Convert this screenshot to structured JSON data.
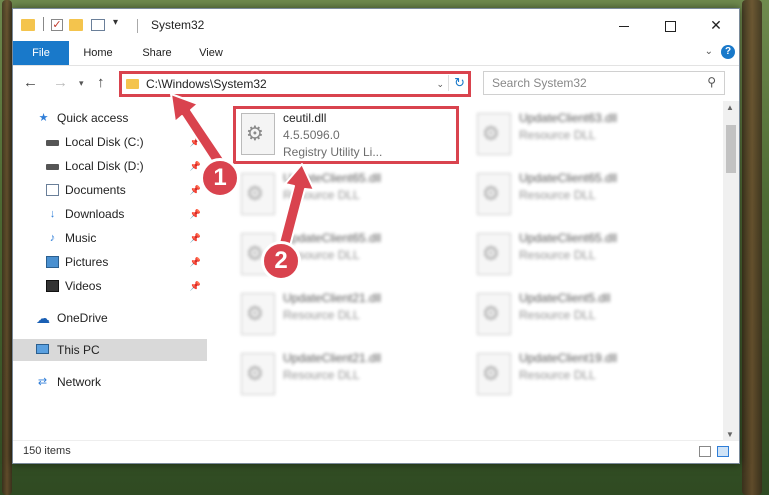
{
  "window": {
    "title": "System32",
    "controls": {
      "minimize": "",
      "maximize": "",
      "close": "✕"
    }
  },
  "quick_access_toolbar": {
    "check": "✓",
    "dropdown": "▾"
  },
  "ribbon": {
    "tabs": [
      {
        "label": "File"
      },
      {
        "label": "Home"
      },
      {
        "label": "Share"
      },
      {
        "label": "View"
      }
    ],
    "expand_icon": "⌄",
    "help_icon": "?"
  },
  "navigation": {
    "back": "←",
    "forward": "→",
    "recent": "▾",
    "up": "↑",
    "address": "C:\\Windows\\System32",
    "address_dropdown": "⌄",
    "refresh": "↻",
    "search_placeholder": "Search System32",
    "search_icon": "⚲"
  },
  "sidebar": {
    "items": [
      {
        "label": "Quick access",
        "icon": "star-icon",
        "pinned": false
      },
      {
        "label": "Local Disk (C:)",
        "icon": "drive-icon",
        "pinned": true
      },
      {
        "label": "Local Disk (D:)",
        "icon": "drive-icon",
        "pinned": true
      },
      {
        "label": "Documents",
        "icon": "documents-icon",
        "pinned": true
      },
      {
        "label": "Downloads",
        "icon": "download-icon",
        "pinned": true
      },
      {
        "label": "Music",
        "icon": "music-icon",
        "pinned": true
      },
      {
        "label": "Pictures",
        "icon": "pictures-icon",
        "pinned": true
      },
      {
        "label": "Videos",
        "icon": "videos-icon",
        "pinned": true
      },
      {
        "label": "OneDrive",
        "icon": "cloud-icon",
        "pinned": false
      },
      {
        "label": "This PC",
        "icon": "computer-icon",
        "pinned": false,
        "selected": true
      },
      {
        "label": "Network",
        "icon": "network-icon",
        "pinned": false
      }
    ],
    "pin_glyph": "📌"
  },
  "files": [
    {
      "name": "ceutil.dll",
      "line2": "4.5.5096.0",
      "line3": "Registry Utility Li...",
      "highlighted": true
    },
    {
      "name": "UpdateClient63.dll",
      "line2": "Resource DLL"
    },
    {
      "name": "UpdateClient65.dll",
      "line2": "Resource DLL"
    },
    {
      "name": "UpdateClient65.dll",
      "line2": "Resource DLL"
    },
    {
      "name": "UpdateClient65.dll",
      "line2": "Resource DLL"
    },
    {
      "name": "UpdateClient65.dll",
      "line2": "Resource DLL"
    },
    {
      "name": "UpdateClient21.dll",
      "line2": "Resource DLL"
    },
    {
      "name": "UpdateClient5.dll",
      "line2": "Resource DLL"
    },
    {
      "name": "UpdateClient21.dll",
      "line2": "Resource DLL"
    },
    {
      "name": "UpdateClient19.dll",
      "line2": "Resource DLL"
    }
  ],
  "file_icon_glyph": "⚙",
  "scrollbar": {
    "up": "▲",
    "down": "▼"
  },
  "status": {
    "item_count": "150 items"
  },
  "annotations": {
    "step1": "1",
    "step2": "2"
  },
  "colors": {
    "accent": "#1979ca",
    "highlight": "#d9434e",
    "folder": "#f4c44d"
  }
}
